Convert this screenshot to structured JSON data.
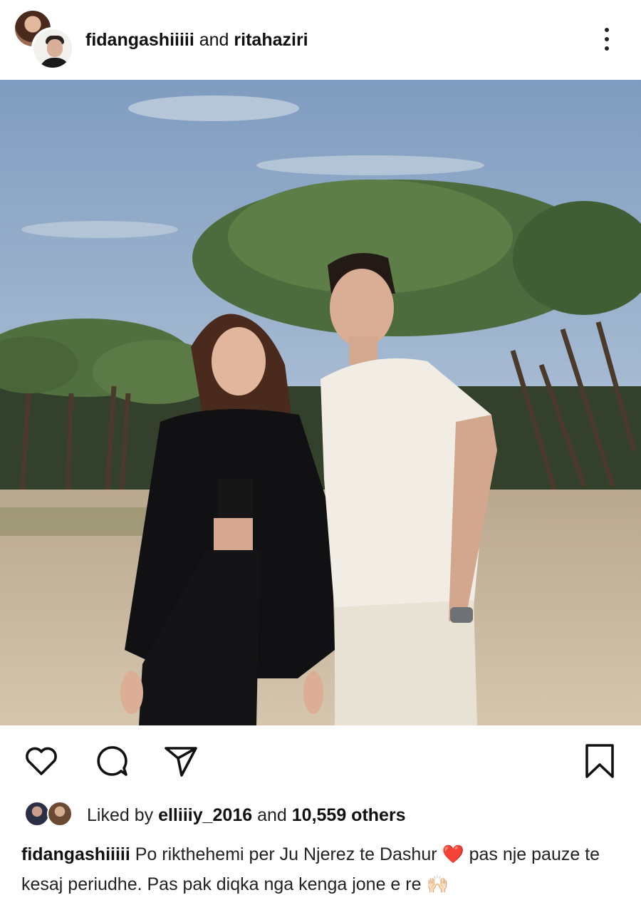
{
  "post": {
    "author1": "fidangashiiiii",
    "joiner": "and",
    "author2": "ritahaziri",
    "more_icon": "more-vertical-icon"
  },
  "actions": {
    "like_icon": "heart-outline-icon",
    "comment_icon": "comment-icon",
    "share_icon": "send-icon",
    "save_icon": "bookmark-icon"
  },
  "likes": {
    "prefix": "Liked by",
    "user": "elliiiy_2016",
    "joiner": "and",
    "count": "10,559 others"
  },
  "caption": {
    "username": "fidangashiiiii",
    "text_part1": "Po rikthehemi per Ju Njerez te Dashur",
    "heart_emoji": "❤️",
    "text_part2": "pas nje pauze te kesaj periudhe. Pas pak diqka nga kenga jone e re",
    "hands_emoji": "🙌🏻"
  },
  "colors": {
    "text": "#111111",
    "heart": "#e0141e",
    "sky": "#9cb3cd",
    "sand": "#c9b79d",
    "trees": "#4a6b3e"
  }
}
